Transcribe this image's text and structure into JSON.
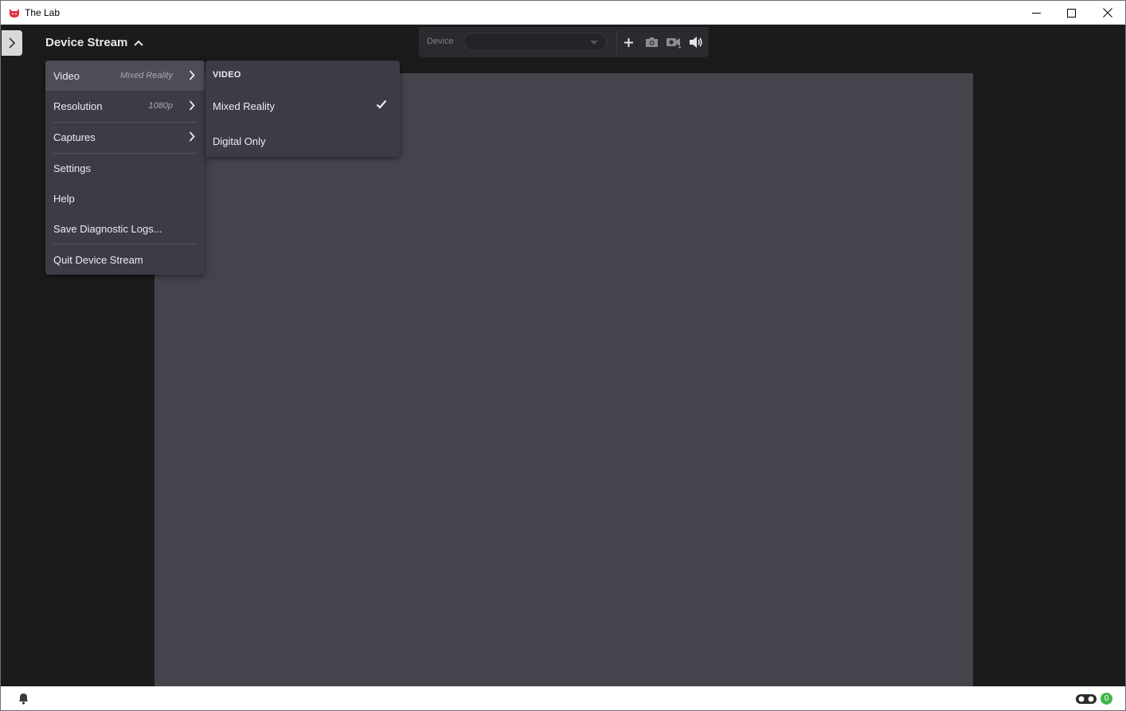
{
  "window": {
    "title": "The Lab",
    "logo_icon": "cat-head-logo-icon",
    "logo_color": "#e0303c"
  },
  "header": {
    "app_name": "Device Stream",
    "caret_icon": "chevron-up-icon"
  },
  "device_bar": {
    "device_label": "Device",
    "device_value": "",
    "icons": [
      "plus-icon",
      "camera-icon",
      "video-camera-icon",
      "speaker-icon"
    ]
  },
  "menu": {
    "items": [
      {
        "label": "Video",
        "value": "Mixed Reality",
        "has_submenu": true
      },
      {
        "label": "Resolution",
        "value": "1080p",
        "has_submenu": true
      },
      {
        "label": "Captures",
        "value": "",
        "has_submenu": true
      },
      {
        "label": "Settings"
      },
      {
        "label": "Help"
      },
      {
        "label": "Save Diagnostic Logs..."
      },
      {
        "label": "Quit Device Stream"
      }
    ]
  },
  "submenu": {
    "header": "VIDEO",
    "items": [
      {
        "label": "Mixed Reality",
        "checked": true
      },
      {
        "label": "Digital Only",
        "checked": false
      }
    ]
  },
  "statusbar": {
    "notification_icon": "bell-icon",
    "headset_icon": "headset-icon",
    "badge_count": "0",
    "badge_color": "#43b649"
  },
  "colors": {
    "background": "#1b1b1b",
    "stage": "#44444c",
    "menu_bg": "#3c3c46",
    "menu_active": "#4d4d58"
  }
}
